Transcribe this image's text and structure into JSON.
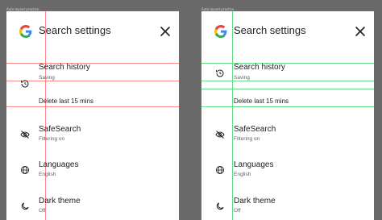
{
  "frames": [
    {
      "label": "Auto layout practice",
      "header": {
        "title": "Search settings",
        "logo_icon": "google-g-icon",
        "close_icon": "close-icon"
      },
      "guides_color": "#ff8a8a",
      "items": [
        {
          "title": "Search history",
          "subtitle": "Saving",
          "icon": "history-icon"
        },
        {
          "title": "Delete last 15 mins",
          "subtitle": "",
          "icon": ""
        },
        {
          "title": "SafeSearch",
          "subtitle": "Filtering on",
          "icon": "eye-off-icon"
        },
        {
          "title": "Languages",
          "subtitle": "English",
          "icon": "globe-icon"
        },
        {
          "title": "Dark theme",
          "subtitle": "Off",
          "icon": "moon-icon"
        }
      ]
    },
    {
      "label": "Auto layout practice",
      "header": {
        "title": "Search settings",
        "logo_icon": "google-g-icon",
        "close_icon": "close-icon"
      },
      "guides_color": "#66dd88",
      "items": [
        {
          "title": "Search history",
          "subtitle": "Saving",
          "icon": "history-icon"
        },
        {
          "title": "Delete last 15 mins",
          "subtitle": "",
          "icon": ""
        },
        {
          "title": "SafeSearch",
          "subtitle": "Filtering on",
          "icon": "eye-off-icon"
        },
        {
          "title": "Languages",
          "subtitle": "English",
          "icon": "globe-icon"
        },
        {
          "title": "Dark theme",
          "subtitle": "Off",
          "icon": "moon-icon"
        }
      ]
    }
  ]
}
